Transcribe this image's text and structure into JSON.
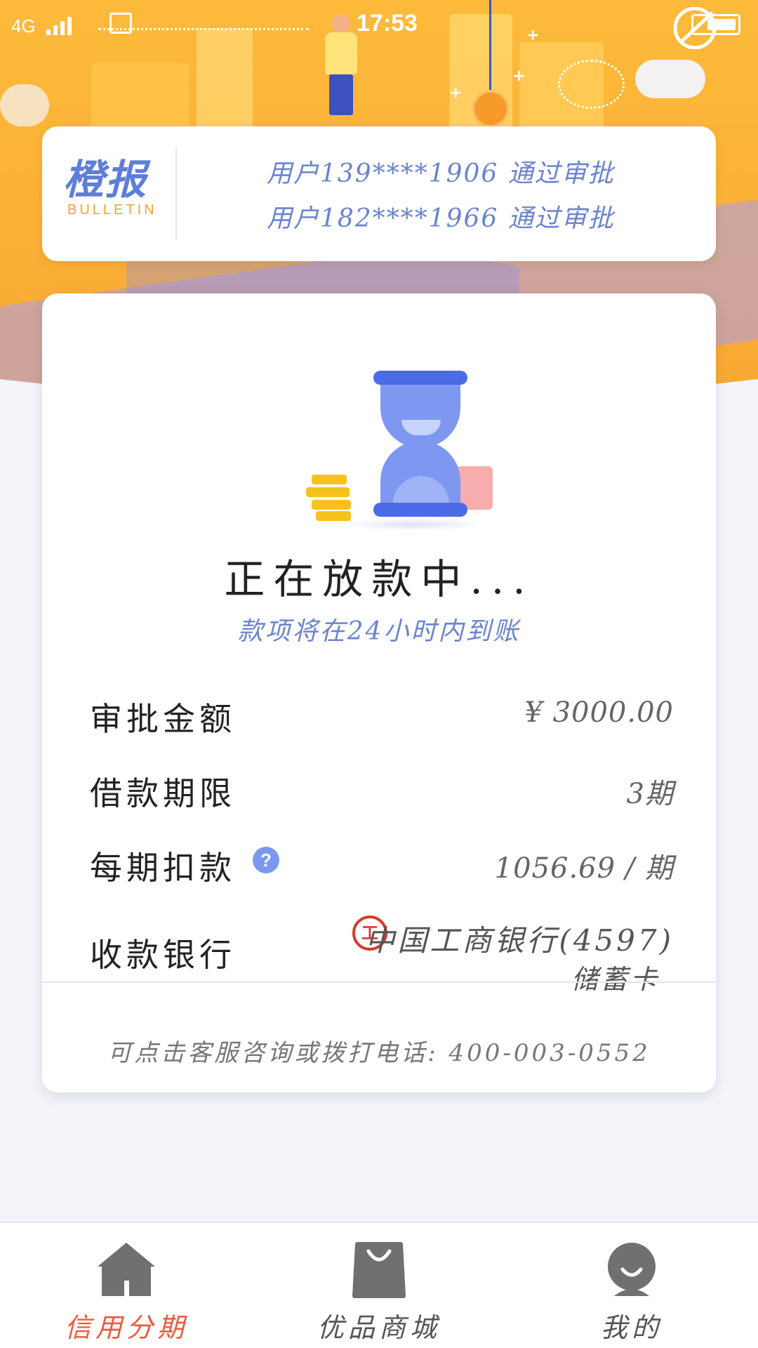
{
  "status_bar": {
    "network": "4G",
    "time": "17:53"
  },
  "bulletin": {
    "logo_cn": "橙报",
    "logo_en": "BULLETIN",
    "items": [
      "用户139****1906 通过审批",
      "用户182****1966 通过审批"
    ]
  },
  "status": {
    "title": "正在放款中...",
    "subtitle": "款项将在24小时内到账"
  },
  "details": {
    "amount_label": "审批金额",
    "amount_value": "¥ 3000.00",
    "term_label": "借款期限",
    "term_value": "3期",
    "installment_label": "每期扣款",
    "installment_value": "1056.69 / 期",
    "bank_label": "收款银行",
    "bank_name": "中国工商银行(4597)",
    "bank_type": "储蓄卡"
  },
  "contact": "可点击客服咨询或拨打电话:  400-003-0552",
  "nav": {
    "items": [
      {
        "label": "信用分期",
        "icon": "home-icon",
        "active": true
      },
      {
        "label": "优品商城",
        "icon": "shopping-bag-icon",
        "active": false
      },
      {
        "label": "我的",
        "icon": "profile-icon",
        "active": false
      }
    ]
  },
  "colors": {
    "accent": "#6a84cf",
    "active_nav": "#ec5a3f",
    "hero": "#fbb036",
    "bank_red": "#d63a2f"
  }
}
